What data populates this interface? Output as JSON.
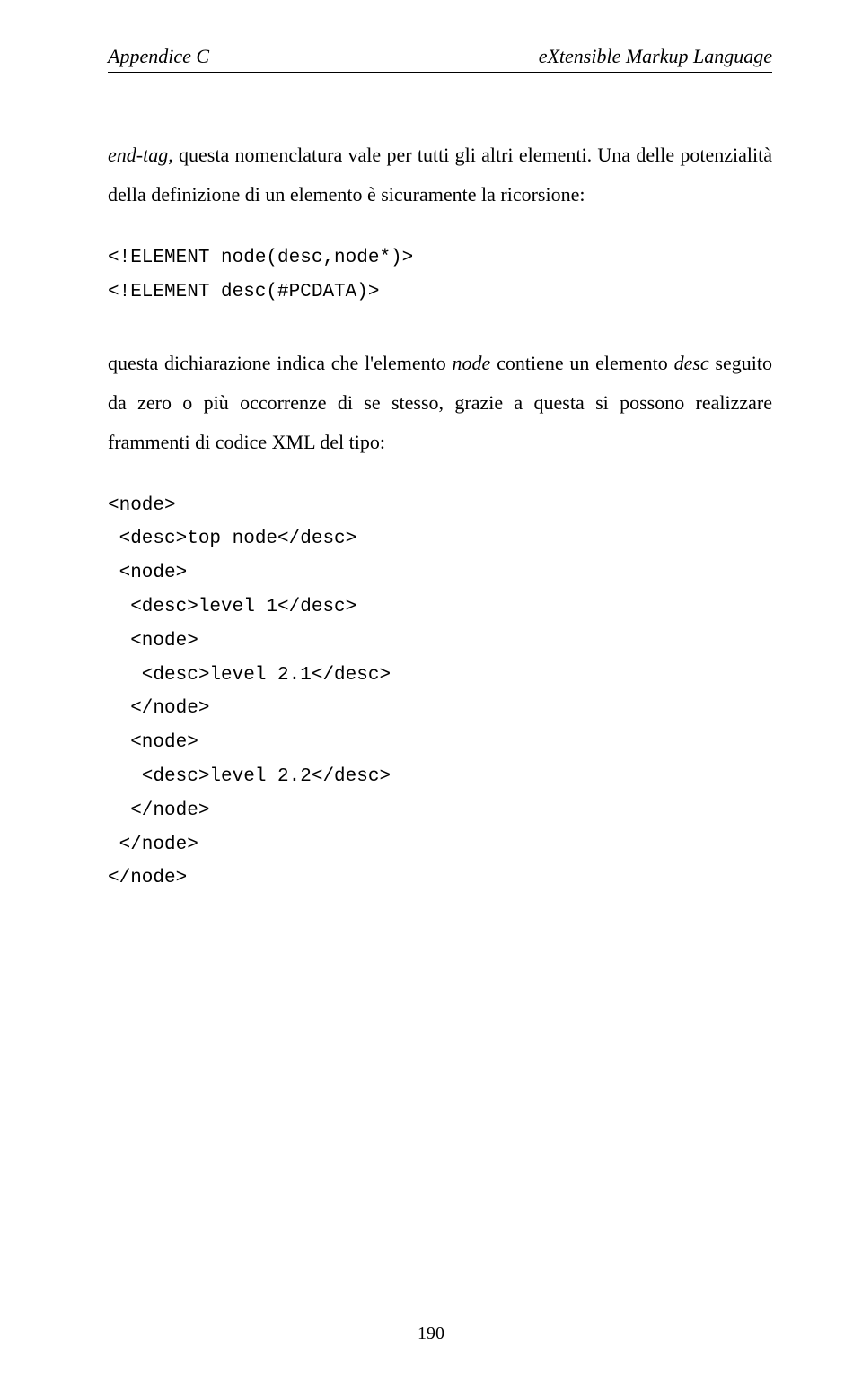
{
  "header": {
    "left": "Appendice C",
    "right_prefix": "e",
    "right_rest": "Xtensible Markup Language"
  },
  "para1": {
    "t1": "end-tag,",
    "t2": "  questa  nomenclatura  vale    per  tutti  gli  altri  elementi. Una delle potenzialità della definizione di un elemento è sicuramente la  ricorsione:"
  },
  "code1": "<!ELEMENT node(desc,node*)>\n<!ELEMENT desc(#PCDATA)>",
  "para2": {
    "t1": "questa dichiarazione indica che l'elemento ",
    "t2": "node",
    "t3": " contiene un elemento ",
    "t4": "desc",
    "t5": " seguito da zero o più occorrenze di se  stesso, grazie a questa si possono realizzare frammenti di codice XML del tipo:"
  },
  "code2": "<node>\n <desc>top node</desc>\n <node>\n  <desc>level 1</desc>\n  <node>\n   <desc>level 2.1</desc>\n  </node>\n  <node>\n   <desc>level 2.2</desc>\n  </node>\n </node>\n</node>",
  "page_number": "190"
}
